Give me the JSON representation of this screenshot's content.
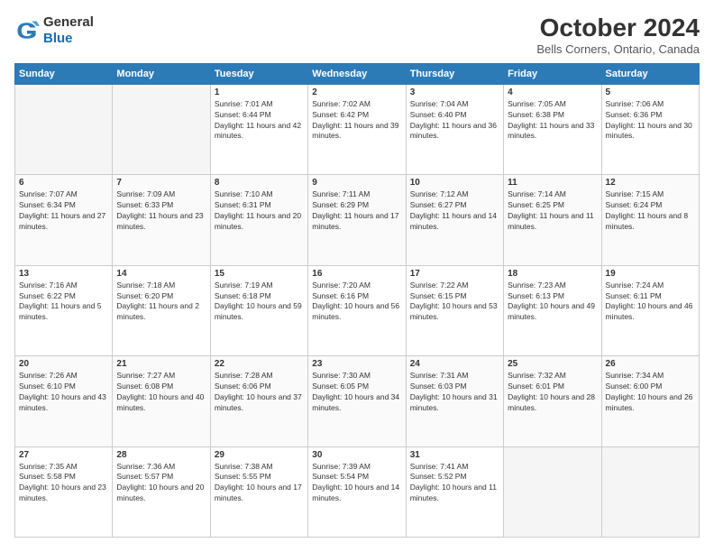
{
  "logo": {
    "line1": "General",
    "line2": "Blue"
  },
  "header": {
    "month": "October 2024",
    "location": "Bells Corners, Ontario, Canada"
  },
  "weekdays": [
    "Sunday",
    "Monday",
    "Tuesday",
    "Wednesday",
    "Thursday",
    "Friday",
    "Saturday"
  ],
  "weeks": [
    [
      {
        "num": "",
        "info": ""
      },
      {
        "num": "",
        "info": ""
      },
      {
        "num": "1",
        "info": "Sunrise: 7:01 AM\nSunset: 6:44 PM\nDaylight: 11 hours and 42 minutes."
      },
      {
        "num": "2",
        "info": "Sunrise: 7:02 AM\nSunset: 6:42 PM\nDaylight: 11 hours and 39 minutes."
      },
      {
        "num": "3",
        "info": "Sunrise: 7:04 AM\nSunset: 6:40 PM\nDaylight: 11 hours and 36 minutes."
      },
      {
        "num": "4",
        "info": "Sunrise: 7:05 AM\nSunset: 6:38 PM\nDaylight: 11 hours and 33 minutes."
      },
      {
        "num": "5",
        "info": "Sunrise: 7:06 AM\nSunset: 6:36 PM\nDaylight: 11 hours and 30 minutes."
      }
    ],
    [
      {
        "num": "6",
        "info": "Sunrise: 7:07 AM\nSunset: 6:34 PM\nDaylight: 11 hours and 27 minutes."
      },
      {
        "num": "7",
        "info": "Sunrise: 7:09 AM\nSunset: 6:33 PM\nDaylight: 11 hours and 23 minutes."
      },
      {
        "num": "8",
        "info": "Sunrise: 7:10 AM\nSunset: 6:31 PM\nDaylight: 11 hours and 20 minutes."
      },
      {
        "num": "9",
        "info": "Sunrise: 7:11 AM\nSunset: 6:29 PM\nDaylight: 11 hours and 17 minutes."
      },
      {
        "num": "10",
        "info": "Sunrise: 7:12 AM\nSunset: 6:27 PM\nDaylight: 11 hours and 14 minutes."
      },
      {
        "num": "11",
        "info": "Sunrise: 7:14 AM\nSunset: 6:25 PM\nDaylight: 11 hours and 11 minutes."
      },
      {
        "num": "12",
        "info": "Sunrise: 7:15 AM\nSunset: 6:24 PM\nDaylight: 11 hours and 8 minutes."
      }
    ],
    [
      {
        "num": "13",
        "info": "Sunrise: 7:16 AM\nSunset: 6:22 PM\nDaylight: 11 hours and 5 minutes."
      },
      {
        "num": "14",
        "info": "Sunrise: 7:18 AM\nSunset: 6:20 PM\nDaylight: 11 hours and 2 minutes."
      },
      {
        "num": "15",
        "info": "Sunrise: 7:19 AM\nSunset: 6:18 PM\nDaylight: 10 hours and 59 minutes."
      },
      {
        "num": "16",
        "info": "Sunrise: 7:20 AM\nSunset: 6:16 PM\nDaylight: 10 hours and 56 minutes."
      },
      {
        "num": "17",
        "info": "Sunrise: 7:22 AM\nSunset: 6:15 PM\nDaylight: 10 hours and 53 minutes."
      },
      {
        "num": "18",
        "info": "Sunrise: 7:23 AM\nSunset: 6:13 PM\nDaylight: 10 hours and 49 minutes."
      },
      {
        "num": "19",
        "info": "Sunrise: 7:24 AM\nSunset: 6:11 PM\nDaylight: 10 hours and 46 minutes."
      }
    ],
    [
      {
        "num": "20",
        "info": "Sunrise: 7:26 AM\nSunset: 6:10 PM\nDaylight: 10 hours and 43 minutes."
      },
      {
        "num": "21",
        "info": "Sunrise: 7:27 AM\nSunset: 6:08 PM\nDaylight: 10 hours and 40 minutes."
      },
      {
        "num": "22",
        "info": "Sunrise: 7:28 AM\nSunset: 6:06 PM\nDaylight: 10 hours and 37 minutes."
      },
      {
        "num": "23",
        "info": "Sunrise: 7:30 AM\nSunset: 6:05 PM\nDaylight: 10 hours and 34 minutes."
      },
      {
        "num": "24",
        "info": "Sunrise: 7:31 AM\nSunset: 6:03 PM\nDaylight: 10 hours and 31 minutes."
      },
      {
        "num": "25",
        "info": "Sunrise: 7:32 AM\nSunset: 6:01 PM\nDaylight: 10 hours and 28 minutes."
      },
      {
        "num": "26",
        "info": "Sunrise: 7:34 AM\nSunset: 6:00 PM\nDaylight: 10 hours and 26 minutes."
      }
    ],
    [
      {
        "num": "27",
        "info": "Sunrise: 7:35 AM\nSunset: 5:58 PM\nDaylight: 10 hours and 23 minutes."
      },
      {
        "num": "28",
        "info": "Sunrise: 7:36 AM\nSunset: 5:57 PM\nDaylight: 10 hours and 20 minutes."
      },
      {
        "num": "29",
        "info": "Sunrise: 7:38 AM\nSunset: 5:55 PM\nDaylight: 10 hours and 17 minutes."
      },
      {
        "num": "30",
        "info": "Sunrise: 7:39 AM\nSunset: 5:54 PM\nDaylight: 10 hours and 14 minutes."
      },
      {
        "num": "31",
        "info": "Sunrise: 7:41 AM\nSunset: 5:52 PM\nDaylight: 10 hours and 11 minutes."
      },
      {
        "num": "",
        "info": ""
      },
      {
        "num": "",
        "info": ""
      }
    ]
  ]
}
